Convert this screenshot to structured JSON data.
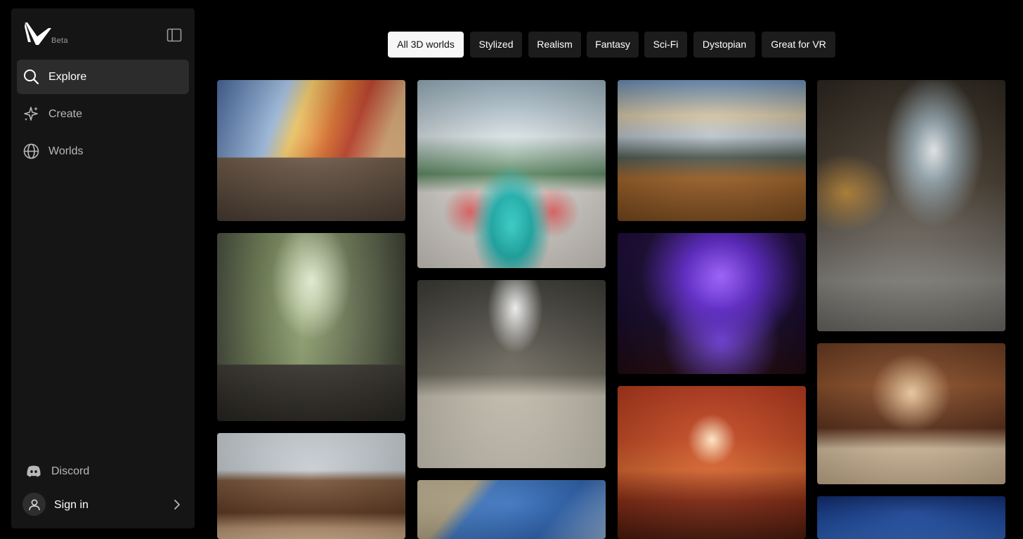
{
  "sidebar": {
    "beta_label": "Beta",
    "nav": [
      {
        "label": "Explore",
        "icon": "search-icon",
        "active": true
      },
      {
        "label": "Create",
        "icon": "sparkle-icon",
        "active": false
      },
      {
        "label": "Worlds",
        "icon": "globe-icon",
        "active": false
      }
    ],
    "discord_label": "Discord",
    "signin_label": "Sign in"
  },
  "filters": [
    {
      "label": "All 3D worlds",
      "active": true
    },
    {
      "label": "Stylized",
      "active": false
    },
    {
      "label": "Realism",
      "active": false
    },
    {
      "label": "Fantasy",
      "active": false
    },
    {
      "label": "Sci-Fi",
      "active": false
    },
    {
      "label": "Dystopian",
      "active": false
    },
    {
      "label": "Great for VR",
      "active": false
    }
  ],
  "colors": {
    "background": "#000000",
    "sidebar": "#151515",
    "active_nav": "#2c2c2c",
    "chip": "#1c1c1c",
    "chip_active": "#f7f7f7"
  }
}
